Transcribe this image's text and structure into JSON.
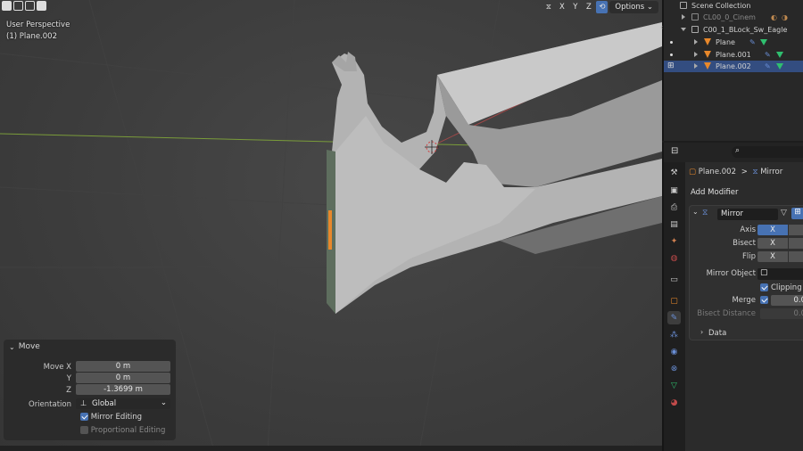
{
  "viewport": {
    "title": "User Perspective",
    "object_label": "(1) Plane.002",
    "header": {
      "axis_x": "X",
      "axis_y": "Y",
      "axis_z": "Z",
      "options_label": "Options",
      "options_chevron": "⌄"
    }
  },
  "move_panel": {
    "title": "Move",
    "move_x_label": "Move X",
    "move_x_value": "0 m",
    "y_label": "Y",
    "y_value": "0 m",
    "z_label": "Z",
    "z_value": "-1.3699 m",
    "orientation_label": "Orientation",
    "orientation_value": "Global",
    "mirror_editing_label": "Mirror Editing",
    "mirror_editing_checked": true,
    "proportional_editing_label": "Proportional Editing",
    "proportional_editing_checked": false
  },
  "outliner": {
    "items": [
      {
        "label": "Scene Collection"
      },
      {
        "label": "CL00_0_Cinem"
      },
      {
        "label": "C00_1_BLock_Sw_Eagle"
      },
      {
        "label": "Plane"
      },
      {
        "label": "Plane.001"
      },
      {
        "label": "Plane.002",
        "selected": true
      }
    ]
  },
  "properties": {
    "breadcrumb_object": "Plane.002",
    "breadcrumb_sep": ">",
    "breadcrumb_modifier": "Mirror",
    "add_modifier_label": "Add Modifier",
    "modifier": {
      "name": "Mirror",
      "axis_label": "Axis",
      "axis_x": "X",
      "bisect_label": "Bisect",
      "bisect_x": "X",
      "flip_label": "Flip",
      "flip_x": "X",
      "mirror_object_label": "Mirror Object",
      "clipping_label": "Clipping",
      "clipping_checked": true,
      "merge_label": "Merge",
      "merge_value": "0.0",
      "bisect_distance_label": "Bisect Distance",
      "bisect_distance_value": "0.0",
      "data_section_label": "Data"
    }
  },
  "colors": {
    "accent": "#4772b3",
    "selection": "#334d80",
    "mesh_orange": "#e8882b",
    "vertex_green": "#2fbf6f"
  }
}
